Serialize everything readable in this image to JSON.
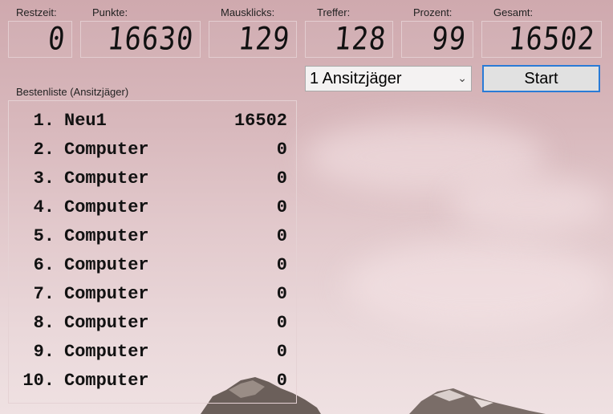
{
  "stats": [
    {
      "label": "Restzeit:",
      "value": "0"
    },
    {
      "label": "Punkte:",
      "value": "16630"
    },
    {
      "label": "Mausklicks:",
      "value": "129"
    },
    {
      "label": "Treffer:",
      "value": "128"
    },
    {
      "label": "Prozent:",
      "value": "99"
    },
    {
      "label": "Gesamt:",
      "value": "16502"
    }
  ],
  "mode_select": {
    "value": "1 Ansitzjäger"
  },
  "start_button": {
    "label": "Start"
  },
  "highscores": {
    "title": "Bestenliste (Ansitzjäger)",
    "entries": [
      {
        "rank": "1.",
        "name": "Neu1",
        "score": "16502"
      },
      {
        "rank": "2.",
        "name": "Computer",
        "score": "0"
      },
      {
        "rank": "3.",
        "name": "Computer",
        "score": "0"
      },
      {
        "rank": "4.",
        "name": "Computer",
        "score": "0"
      },
      {
        "rank": "5.",
        "name": "Computer",
        "score": "0"
      },
      {
        "rank": "6.",
        "name": "Computer",
        "score": "0"
      },
      {
        "rank": "7.",
        "name": "Computer",
        "score": "0"
      },
      {
        "rank": "8.",
        "name": "Computer",
        "score": "0"
      },
      {
        "rank": "9.",
        "name": "Computer",
        "score": "0"
      },
      {
        "rank": "10.",
        "name": "Computer",
        "score": "0"
      }
    ]
  },
  "colors": {
    "focus_border": "#2a7bd6",
    "sky_top": "#cfa9ae",
    "sky_bottom": "#efe1e2"
  }
}
